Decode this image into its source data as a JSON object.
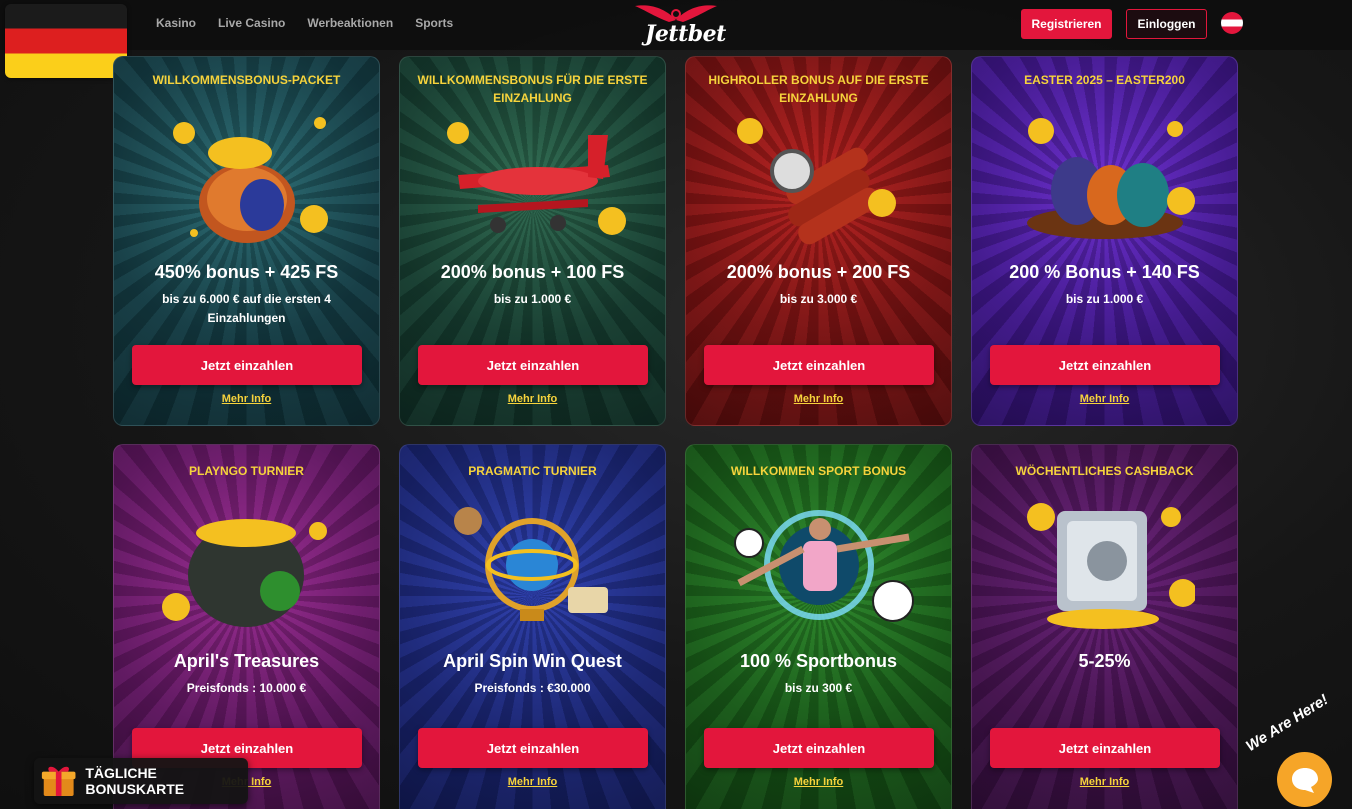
{
  "header": {
    "nav": [
      "Kasino",
      "Live Casino",
      "Werbeaktionen",
      "Sports"
    ],
    "logo": "Jettbet",
    "register_label": "Registrieren",
    "login_label": "Einloggen"
  },
  "cards": [
    {
      "title": "WILLKOMMENSBONUS-PACKET",
      "headline": "450% bonus + 425 FS",
      "sub": "bis zu 6.000 € auf die ersten 4 Einzahlungen",
      "button": "Jetzt einzahlen",
      "link": "Mehr Info"
    },
    {
      "title": "WILLKOMMENSBONUS FÜR DIE ERSTE EINZAHLUNG",
      "headline": "200% bonus + 100 FS",
      "sub": "bis zu 1.000 €",
      "button": "Jetzt einzahlen",
      "link": "Mehr Info"
    },
    {
      "title": "HIGHROLLER BONUS AUF DIE ERSTE EINZAHLUNG",
      "headline": "200% bonus + 200 FS",
      "sub": "bis zu 3.000 €",
      "button": "Jetzt einzahlen",
      "link": "Mehr Info"
    },
    {
      "title": "EASTER 2025 – EASTER200",
      "headline": "200 % Bonus + 140 FS",
      "sub": "bis zu 1.000 €",
      "button": "Jetzt einzahlen",
      "link": "Mehr Info"
    },
    {
      "title": "PLAYNGO TURNIER",
      "headline": "April's Treasures",
      "sub": "Preisfonds : 10.000 €",
      "button": "Jetzt einzahlen",
      "link": "Mehr Info"
    },
    {
      "title": "PRAGMATIC TURNIER",
      "headline": "April Spin Win Quest",
      "sub": "Preisfonds : €30.000",
      "button": "Jetzt einzahlen",
      "link": "Mehr Info"
    },
    {
      "title": "WILLKOMMEN SPORT BONUS",
      "headline": "100 % Sportbonus",
      "sub": "bis zu 300 €",
      "button": "Jetzt einzahlen",
      "link": "Mehr Info"
    },
    {
      "title": "WÖCHENTLICHES CASHBACK",
      "headline": "5-25%",
      "sub": "",
      "button": "Jetzt einzahlen",
      "link": "Mehr Info"
    }
  ],
  "daily_bonus": "TÄGLICHE BONUSKARTE",
  "chat": {
    "label": "We Are Here!"
  },
  "colors": {
    "accent": "#e3163c",
    "gold": "#f6d33c"
  }
}
